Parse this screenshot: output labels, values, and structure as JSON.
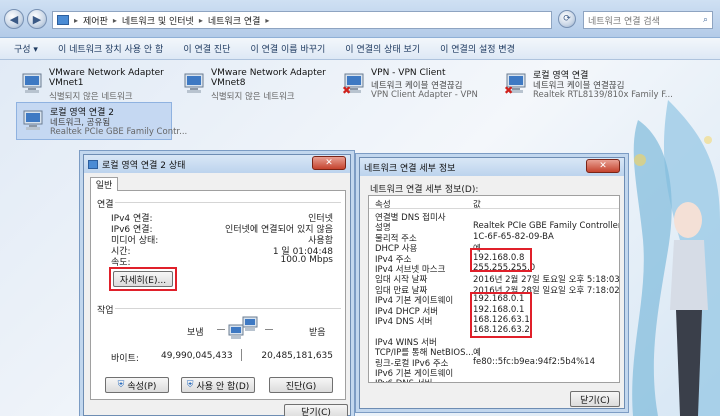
{
  "breadcrumb": [
    "제어판",
    "네트워크 및 인터넷",
    "네트워크 연결"
  ],
  "search": {
    "placeholder": "네트워크 연결 검색"
  },
  "toolbar": {
    "items": [
      "구성",
      "이 네트워크 장치 사용 안 함",
      "이 연결 진단",
      "이 연결 이름 바꾸기",
      "이 연결의 상태 보기",
      "이 연결의 설정 변경"
    ]
  },
  "adapters": [
    {
      "name": "VMware Network Adapter VMnet1",
      "status": "식별되지 않은 네트워크",
      "device": ""
    },
    {
      "name": "VMware Network Adapter VMnet8",
      "status": "식별되지 않은 네트워크",
      "device": ""
    },
    {
      "name": "VPN - VPN Client",
      "status": "네트워크 케이블 연결끊김",
      "device": "VPN Client Adapter - VPN"
    },
    {
      "name": "로컬 영역 연결",
      "status": "네트워크 케이블 연결끊김",
      "device": "Realtek RTL8139/810x Family F..."
    },
    {
      "name": "로컬 영역 연결 2",
      "status": "네트워크, 공유됨",
      "device": "Realtek PCIe GBE Family Contr..."
    }
  ],
  "status_dialog": {
    "title": "로컬 영역 연결 2 상태",
    "tab": "일반",
    "connection_section": "연결",
    "rows": [
      {
        "label": "IPv4 연결:",
        "value": "인터넷"
      },
      {
        "label": "IPv6 연결:",
        "value": "인터넷에 연결되어 있지 않음"
      },
      {
        "label": "미디어 상태:",
        "value": "사용함"
      },
      {
        "label": "시간:",
        "value": "1 일 01:04:48"
      },
      {
        "label": "속도:",
        "value": "100.0 Mbps"
      }
    ],
    "details_button": "자세히(E)...",
    "activity_section": "작업",
    "sent_label": "보냄",
    "received_label": "받음",
    "bytes_label": "바이트:",
    "bytes_sent": "49,990,045,433",
    "bytes_received": "20,485,181,635",
    "properties_button": "속성(P)",
    "disable_button": "사용 안 함(D)",
    "diagnose_button": "진단(G)",
    "close_button": "닫기(C)"
  },
  "details_dialog": {
    "title": "네트워크 연결 세부 정보",
    "subtitle": "네트워크 연결 세부 정보(D):",
    "col_property": "속성",
    "col_value": "값",
    "rows": [
      {
        "label": "연결별 DNS 접미사",
        "value": ""
      },
      {
        "label": "설명",
        "value": "Realtek PCIe GBE Family Controller"
      },
      {
        "label": "물리적 주소",
        "value": "1C-6F-65-82-09-BA"
      },
      {
        "label": "DHCP 사용",
        "value": "예"
      },
      {
        "label": "IPv4 주소",
        "value": "192.168.0.8"
      },
      {
        "label": "IPv4 서브넷 마스크",
        "value": "255.255.255.0"
      },
      {
        "label": "임대 시작 날짜",
        "value": "2016년 2월 27일 토요일 오후 5:18:03"
      },
      {
        "label": "임대 만료 날짜",
        "value": "2016년 2월 28일 일요일 오후 7:18:02"
      },
      {
        "label": "IPv4 기본 게이트웨이",
        "value": "192.168.0.1"
      },
      {
        "label": "IPv4 DHCP 서버",
        "value": "192.168.0.1"
      },
      {
        "label": "IPv4 DNS 서버",
        "value": "168.126.63.1"
      },
      {
        "label": "",
        "value": "168.126.63.2"
      },
      {
        "label": "IPv4 WINS 서버",
        "value": ""
      },
      {
        "label": "TCP/IP를 통해 NetBIOS...",
        "value": "예"
      },
      {
        "label": "링크-로컬 IPv6 주소",
        "value": "fe80::5fc:b9ea:94f2:5b4%14"
      },
      {
        "label": "IPv6 기본 게이트웨이",
        "value": ""
      },
      {
        "label": "IPv6 DNS 서버",
        "value": ""
      }
    ],
    "close_button": "닫기(C)"
  },
  "colors": {
    "highlight_box": "#e0202a",
    "selection": "#c5d8f2"
  }
}
